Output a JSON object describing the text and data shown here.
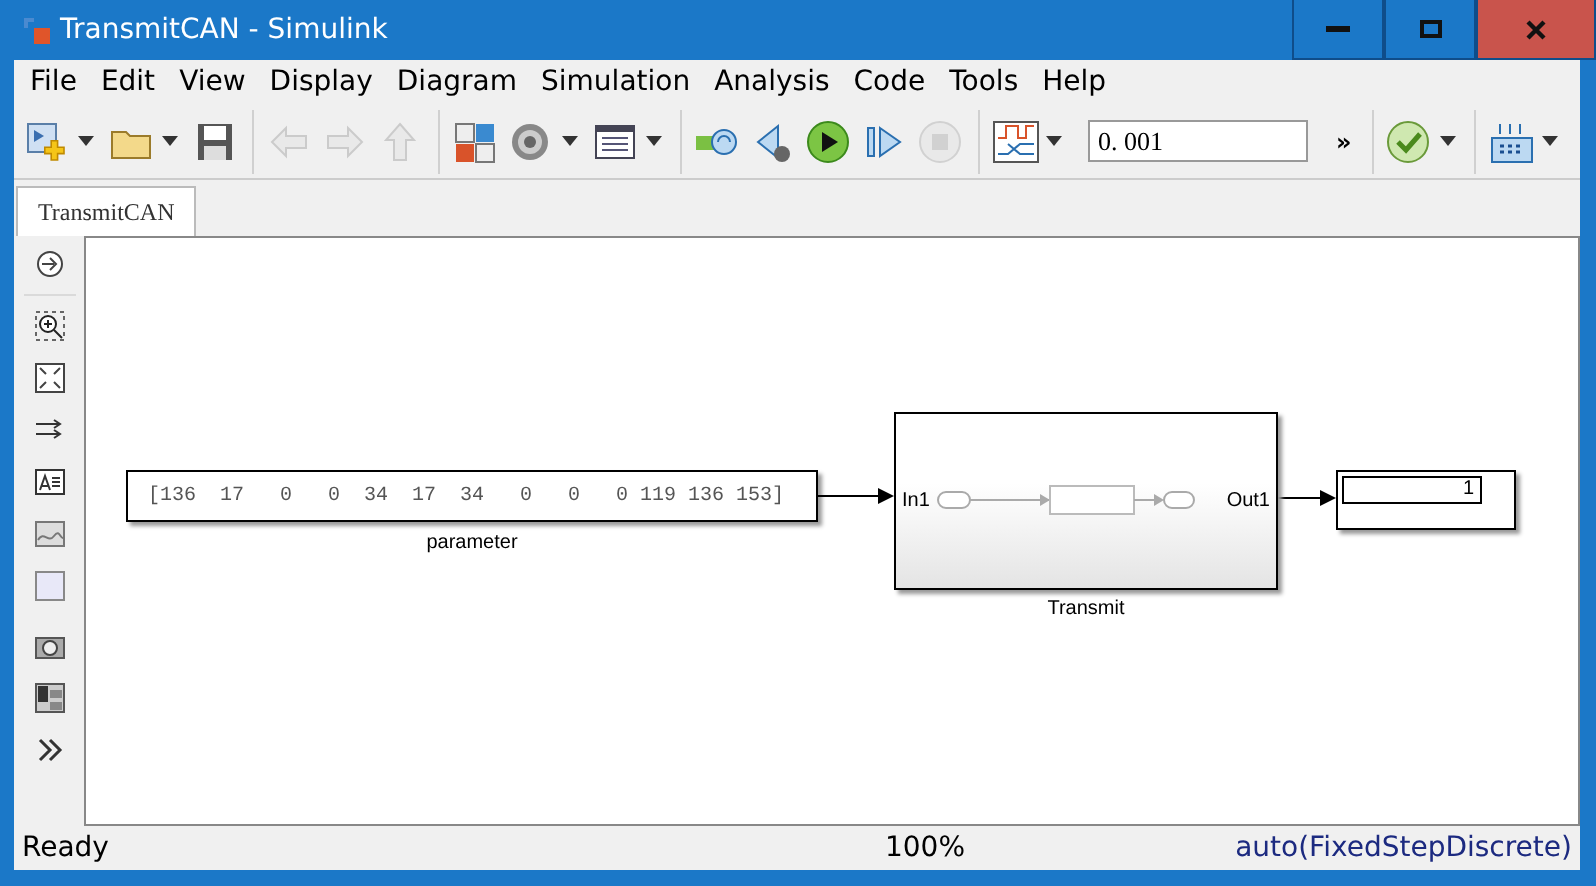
{
  "window": {
    "title": "TransmitCAN - Simulink"
  },
  "menu": [
    {
      "label": "File"
    },
    {
      "label": "Edit"
    },
    {
      "label": "View"
    },
    {
      "label": "Display"
    },
    {
      "label": "Diagram"
    },
    {
      "label": "Simulation"
    },
    {
      "label": "Analysis"
    },
    {
      "label": "Code"
    },
    {
      "label": "Tools"
    },
    {
      "label": "Help"
    }
  ],
  "toolbar": {
    "buttons": [
      {
        "disabled": false,
        "dropdown": true
      },
      {
        "disabled": false,
        "dropdown": true
      },
      {
        "disabled": false,
        "dropdown": false
      },
      {
        "disabled": true,
        "dropdown": false
      },
      {
        "disabled": true,
        "dropdown": false
      },
      {
        "disabled": true,
        "dropdown": false
      },
      {
        "disabled": false,
        "dropdown": false
      },
      {
        "disabled": false,
        "dropdown": true
      },
      {
        "disabled": false,
        "dropdown": true
      },
      {
        "disabled": false,
        "dropdown": false
      },
      {
        "disabled": false,
        "dropdown": false
      },
      {
        "disabled": false,
        "dropdown": false
      },
      {
        "disabled": false,
        "dropdown": false
      },
      {
        "disabled": true,
        "dropdown": false
      },
      {
        "disabled": false,
        "dropdown": true
      }
    ],
    "stop_time": "0. 001",
    "overflow": "»",
    "end_buttons": [
      {
        "disabled": false,
        "dropdown": true
      },
      {
        "disabled": false,
        "dropdown": true
      }
    ]
  },
  "tabs": [
    {
      "label": "TransmitCAN",
      "selected": true
    }
  ],
  "diagram": {
    "constant": {
      "value": "[136  17   0   0  34  17  34   0   0   0 119 136 153]",
      "label": "parameter"
    },
    "subsystem": {
      "inport": "In1",
      "outport": "Out1",
      "label": "Transmit"
    },
    "display": {
      "value": "1"
    }
  },
  "status_bar": {
    "state": "Ready",
    "zoom": "100%",
    "solver": "auto(FixedStepDiscrete)"
  }
}
